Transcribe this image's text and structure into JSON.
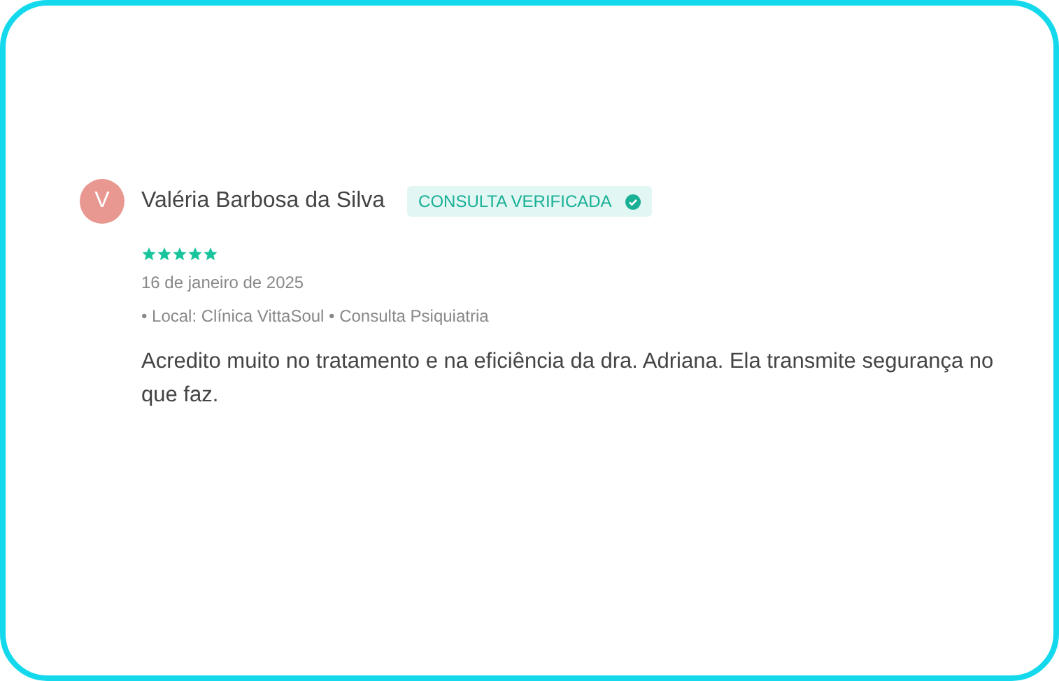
{
  "review": {
    "avatar_initial": "V",
    "author": "Valéria Barbosa da Silva",
    "badge": {
      "label": "CONSULTA VERIFICADA",
      "verified": true
    },
    "stars": 5,
    "date": "16 de janeiro de 2025",
    "location": "• Local: Clínica VittaSoul • Consulta Psiquiatria",
    "text": "Acredito muito no tratamento e na eficiência da dra. Adriana. Ela transmite segurança no que faz."
  }
}
